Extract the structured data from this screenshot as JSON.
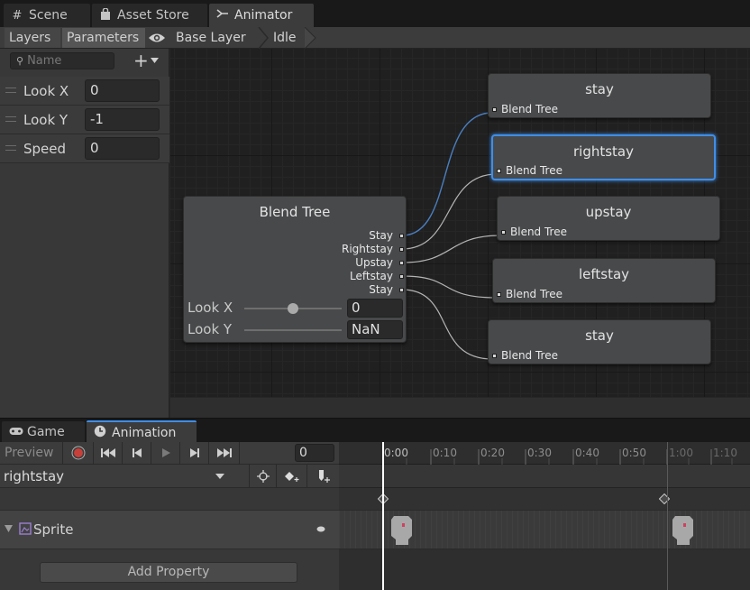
{
  "top_tabs": [
    {
      "label": "Scene",
      "icon": "grid-icon"
    },
    {
      "label": "Asset Store",
      "icon": "bag-icon"
    },
    {
      "label": "Animator",
      "icon": "animator-icon"
    }
  ],
  "breadcrumb": {
    "tabs": [
      "Layers",
      "Parameters"
    ],
    "items": [
      "Base Layer",
      "Idle"
    ]
  },
  "params": {
    "search_placeholder": "Name",
    "items": [
      {
        "label": "Look X",
        "value": "0"
      },
      {
        "label": "Look Y",
        "value": "-1"
      },
      {
        "label": "Speed",
        "value": "0"
      }
    ]
  },
  "blend_tree": {
    "title": "Blend Tree",
    "outputs": [
      "Stay",
      "Rightstay",
      "Upstay",
      "Leftstay",
      "Stay"
    ],
    "look_x_label": "Look X",
    "look_x_value": "0",
    "look_y_label": "Look Y",
    "look_y_value": "NaN"
  },
  "states": [
    {
      "title": "stay",
      "sub": "Blend Tree"
    },
    {
      "title": "rightstay",
      "sub": "Blend Tree"
    },
    {
      "title": "upstay",
      "sub": "Blend Tree"
    },
    {
      "title": "leftstay",
      "sub": "Blend Tree"
    },
    {
      "title": "stay",
      "sub": "Blend Tree"
    }
  ],
  "bottom_tabs": [
    {
      "label": "Game",
      "icon": "gamepad-icon"
    },
    {
      "label": "Animation",
      "icon": "clock-icon"
    }
  ],
  "animation": {
    "preview_label": "Preview",
    "frame": "0",
    "clip": "rightstay",
    "property": "Sprite",
    "add_property": "Add Property",
    "ruler": [
      "0:00",
      "0:10",
      "0:20",
      "0:30",
      "0:40",
      "0:50",
      "1:00",
      "1:10"
    ]
  },
  "colors": {
    "accent": "#3f8ee8",
    "record": "#c8403a",
    "playhead": "#ffffff"
  }
}
